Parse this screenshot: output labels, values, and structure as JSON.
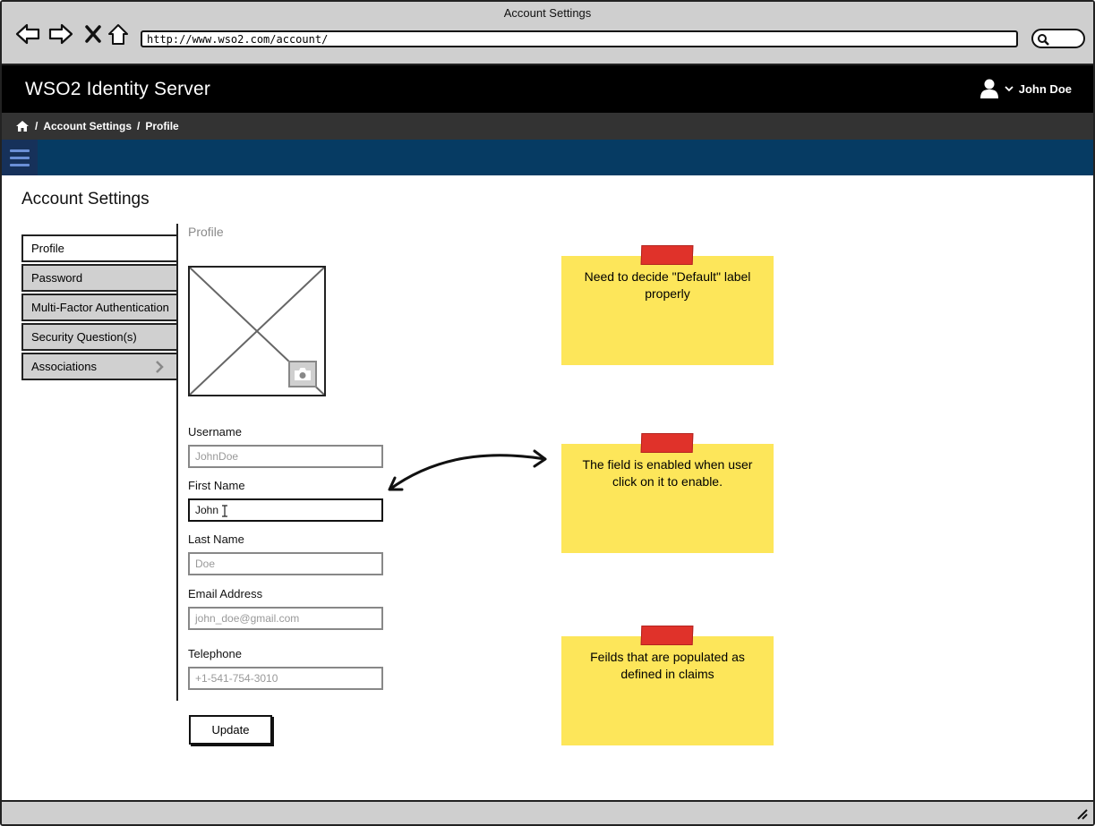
{
  "browser": {
    "window_title": "Account Settings",
    "url": "http://www.wso2.com/account/",
    "nav_icons": [
      "back-icon",
      "forward-icon",
      "stop-icon",
      "home-icon"
    ],
    "search_icon": "search-icon"
  },
  "header": {
    "app_title": "WSO2 Identity Server",
    "user_name": "John Doe",
    "user_icon": "user-icon",
    "dropdown_icon": "chevron-down-icon"
  },
  "breadcrumb": {
    "home_icon": "home-icon",
    "items": [
      "Account Settings",
      "Profile"
    ],
    "separator": "/"
  },
  "page": {
    "title": "Account Settings",
    "section_label": "Profile"
  },
  "side_tabs": [
    {
      "label": "Profile",
      "active": true
    },
    {
      "label": "Password",
      "active": false
    },
    {
      "label": "Multi-Factor Authentication",
      "active": false
    },
    {
      "label": "Security Question(s)",
      "active": false
    },
    {
      "label": "Associations",
      "active": false,
      "has_chevron": true
    }
  ],
  "form": {
    "fields": [
      {
        "label": "Username",
        "value": "JohnDoe",
        "enabled": false
      },
      {
        "label": "First Name",
        "value": "John",
        "enabled": true
      },
      {
        "label": "Last Name",
        "value": "Doe",
        "enabled": false
      },
      {
        "label": "Email Address",
        "value": "john_doe@gmail.com",
        "enabled": false
      },
      {
        "label": "Telephone",
        "value": "+1-541-754-3010",
        "enabled": false
      }
    ],
    "update_label": "Update",
    "camera_icon": "camera-icon"
  },
  "notes": [
    {
      "text": "Need to decide \"Default\" label properly"
    },
    {
      "text": "The field is enabled when user click on it to enable."
    },
    {
      "text": "Feilds that are populated as defined in claims"
    }
  ],
  "colors": {
    "header_bg": "#000000",
    "breadcrumb_bg": "#333333",
    "nav_bar_bg": "#063b63",
    "note_bg": "#fde65a",
    "tape": "#e0322a"
  }
}
